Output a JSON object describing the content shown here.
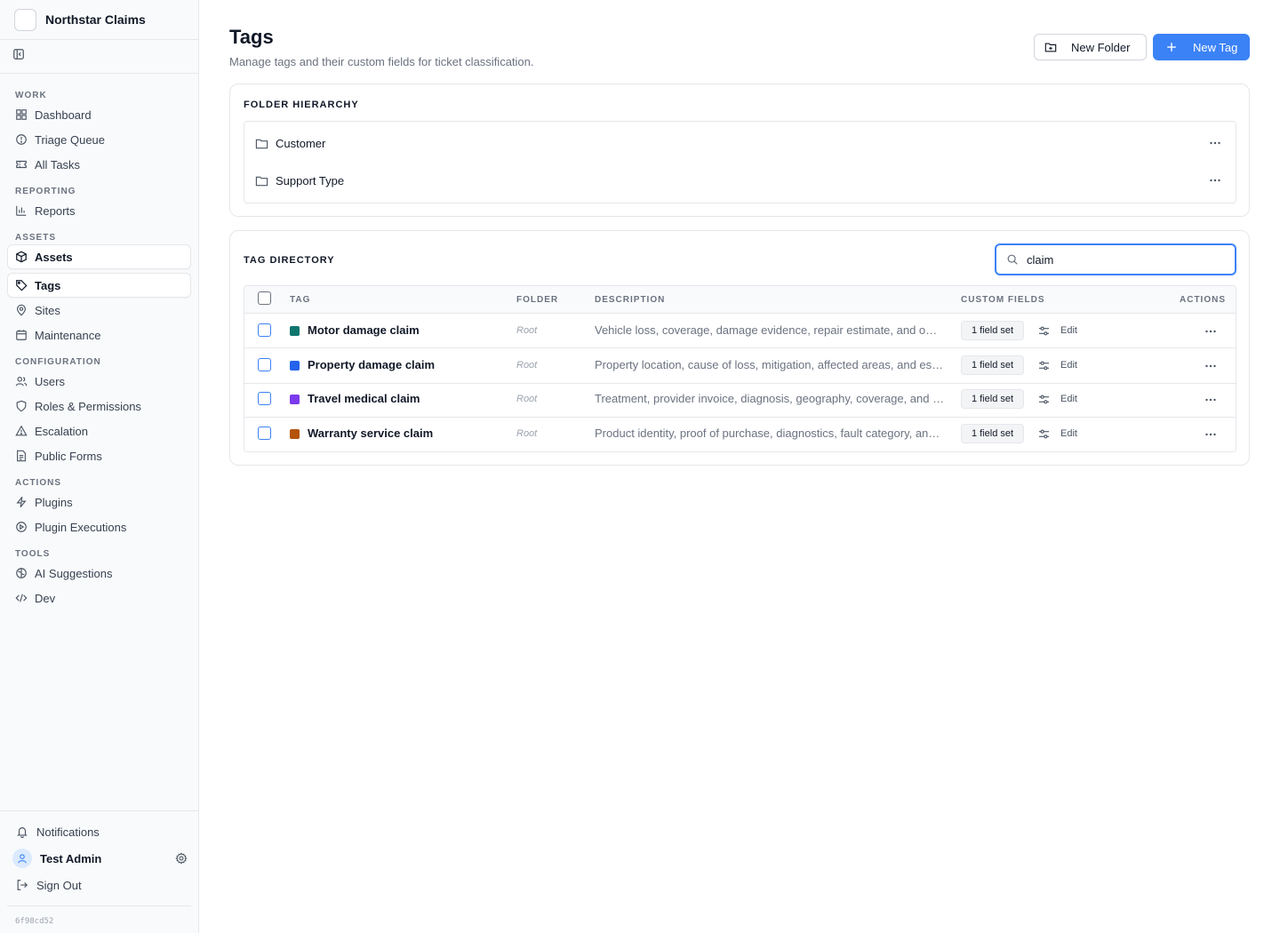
{
  "app": {
    "name": "Northstar Claims",
    "build": "6f98cd52"
  },
  "sidebar": {
    "sections": [
      {
        "title": "WORK",
        "items": [
          {
            "label": "Dashboard",
            "icon": "dashboard-icon"
          },
          {
            "label": "Triage Queue",
            "icon": "alert-circle-icon"
          },
          {
            "label": "All Tasks",
            "icon": "ticket-icon"
          }
        ]
      },
      {
        "title": "REPORTING",
        "items": [
          {
            "label": "Reports",
            "icon": "bar-chart-icon"
          }
        ]
      },
      {
        "title": "ASSETS",
        "items": [
          {
            "label": "Assets",
            "icon": "box-icon"
          },
          {
            "label": "Tags",
            "icon": "tag-icon"
          },
          {
            "label": "Sites",
            "icon": "map-pin-icon"
          },
          {
            "label": "Maintenance",
            "icon": "calendar-icon"
          }
        ]
      },
      {
        "title": "CONFIGURATION",
        "items": [
          {
            "label": "Users",
            "icon": "users-icon"
          },
          {
            "label": "Roles & Permissions",
            "icon": "shield-icon"
          },
          {
            "label": "Escalation",
            "icon": "warning-triangle-icon"
          },
          {
            "label": "Public Forms",
            "icon": "document-icon"
          }
        ]
      },
      {
        "title": "ACTIONS",
        "items": [
          {
            "label": "Plugins",
            "icon": "lightning-icon"
          },
          {
            "label": "Plugin Executions",
            "icon": "play-circle-icon"
          }
        ]
      },
      {
        "title": "TOOLS",
        "items": [
          {
            "label": "AI Suggestions",
            "icon": "brain-icon"
          },
          {
            "label": "Dev",
            "icon": "code-icon"
          }
        ]
      }
    ],
    "active_items": [
      "Assets",
      "Tags"
    ],
    "footer": {
      "notifications": "Notifications",
      "user": "Test Admin",
      "sign_out": "Sign Out"
    }
  },
  "header": {
    "title": "Tags",
    "subtitle": "Manage tags and their custom fields for ticket classification.",
    "new_folder_label": "New Folder",
    "new_tag_label": "New Tag"
  },
  "folders": {
    "heading": "FOLDER HIERARCHY",
    "items": [
      "Customer",
      "Support Type"
    ]
  },
  "directory": {
    "heading": "TAG DIRECTORY",
    "search_value": "claim",
    "columns": {
      "tag": "TAG",
      "folder": "FOLDER",
      "description": "DESCRIPTION",
      "custom_fields": "CUSTOM FIELDS",
      "actions": "ACTIONS"
    },
    "rows": [
      {
        "name": "Motor damage claim",
        "color": "#0f766e",
        "folder": "Root",
        "description": "Vehicle loss, coverage, damage evidence, repair estimate, and ownership.",
        "fields": "1 field set",
        "edit": "Edit"
      },
      {
        "name": "Property damage claim",
        "color": "#2563eb",
        "folder": "Root",
        "description": "Property location, cause of loss, mitigation, affected areas, and estimates.",
        "fields": "1 field set",
        "edit": "Edit"
      },
      {
        "name": "Travel medical claim",
        "color": "#7c3aed",
        "folder": "Root",
        "description": "Treatment, provider invoice, diagnosis, geography, coverage, and dates.",
        "fields": "1 field set",
        "edit": "Edit"
      },
      {
        "name": "Warranty service claim",
        "color": "#b45309",
        "folder": "Root",
        "description": "Product identity, proof of purchase, diagnostics, fault category, and service.",
        "fields": "1 field set",
        "edit": "Edit"
      }
    ]
  },
  "colors": {
    "accent": "#3b82f6",
    "border": "#e5e7eb",
    "muted": "#6b7280"
  }
}
